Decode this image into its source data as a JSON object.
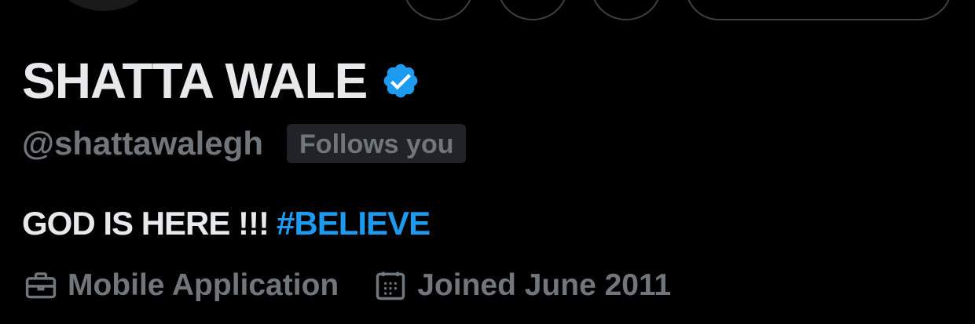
{
  "profile": {
    "name": "SHATTA WALE",
    "handle": "@shattawalegh",
    "follows_you": "Follows you",
    "verified": true
  },
  "bio": {
    "text": "GOD IS HERE !!!",
    "hashtag": "#BELIEVE"
  },
  "meta": {
    "category": "Mobile Application",
    "joined": "Joined June 2011"
  },
  "icons": {
    "verified": "verified-badge-icon",
    "category": "briefcase-icon",
    "joined": "calendar-icon"
  },
  "colors": {
    "background": "#000000",
    "primary_text": "#e7e9ea",
    "secondary_text": "#71767b",
    "accent": "#1d9bf0",
    "badge_bg": "#202327"
  }
}
